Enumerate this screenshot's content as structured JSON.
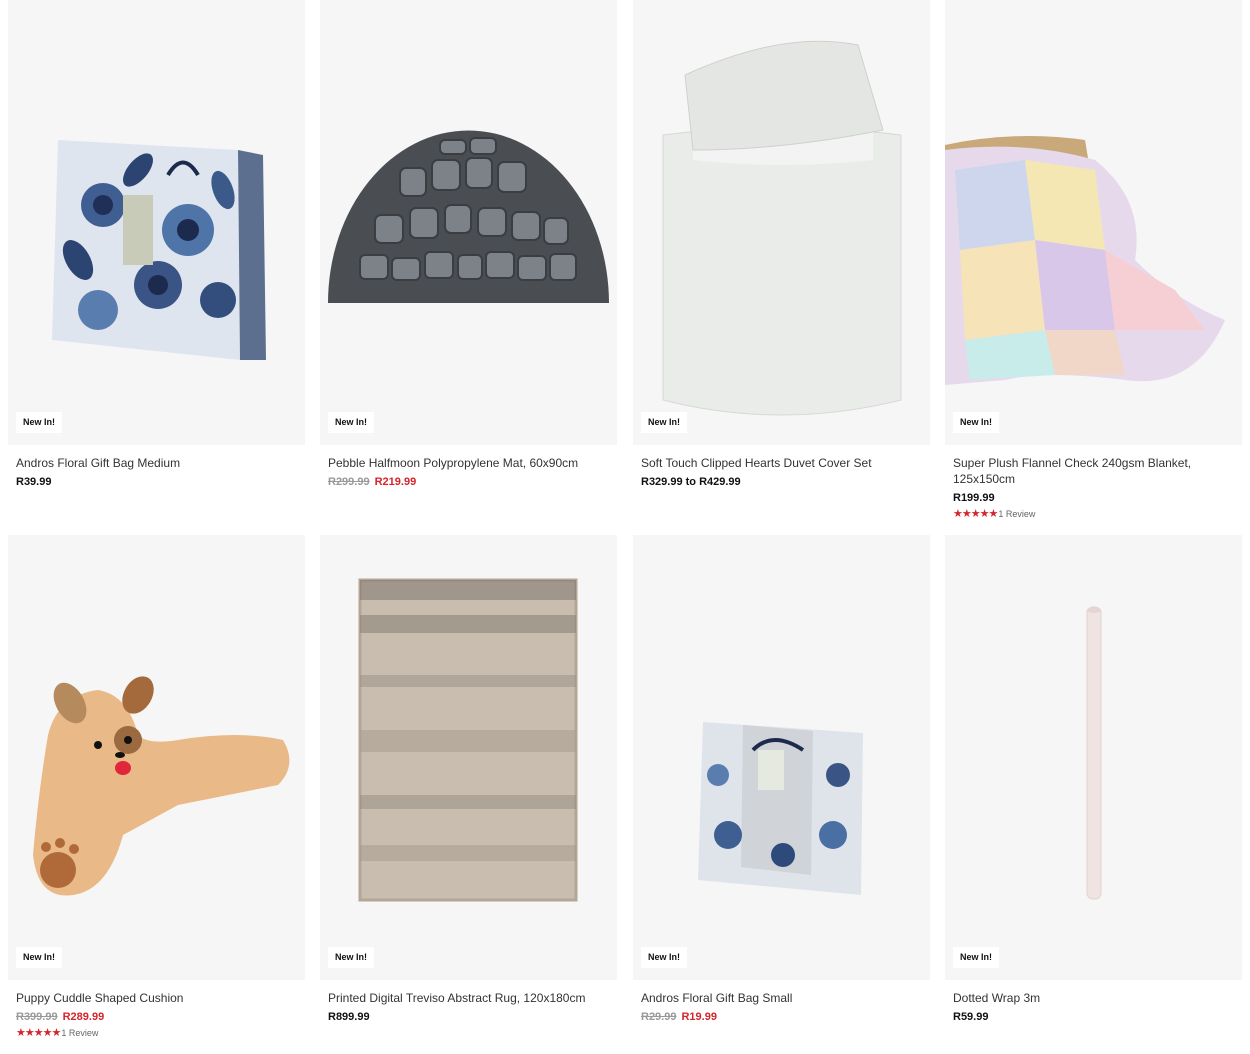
{
  "products": [
    {
      "badge": "New In!",
      "title": "Andros Floral Gift Bag Medium",
      "price": "R39.99",
      "was": null,
      "sale": null,
      "rating": null
    },
    {
      "badge": "New In!",
      "title": "Pebble Halfmoon Polypropylene Mat, 60x90cm",
      "price": null,
      "was": "R299.99",
      "sale": "R219.99",
      "rating": null
    },
    {
      "badge": "New In!",
      "title": "Soft Touch Clipped Hearts Duvet Cover Set",
      "price": "R329.99 to R429.99",
      "was": null,
      "sale": null,
      "rating": null
    },
    {
      "badge": "New In!",
      "title": "Super Plush Flannel Check 240gsm Blanket, 125x150cm",
      "price": "R199.99",
      "was": null,
      "sale": null,
      "rating": {
        "stars": 5,
        "text": "1 Review"
      }
    },
    {
      "badge": "New In!",
      "title": "Puppy Cuddle Shaped Cushion",
      "price": null,
      "was": "R399.99",
      "sale": "R289.99",
      "rating": {
        "stars": 5,
        "text": "1 Review"
      }
    },
    {
      "badge": "New In!",
      "title": "Printed Digital Treviso Abstract Rug, 120x180cm",
      "price": "R899.99",
      "was": null,
      "sale": null,
      "rating": null
    },
    {
      "badge": "New In!",
      "title": "Andros Floral Gift Bag Small",
      "price": null,
      "was": "R29.99",
      "sale": "R19.99",
      "rating": null
    },
    {
      "badge": "New In!",
      "title": "Dotted Wrap 3m",
      "price": "R59.99",
      "was": null,
      "sale": null,
      "rating": null
    }
  ],
  "colors": {
    "sale": "#d6242b",
    "image_bg": "#f6f6f6"
  },
  "icons": [
    "star-icon"
  ]
}
